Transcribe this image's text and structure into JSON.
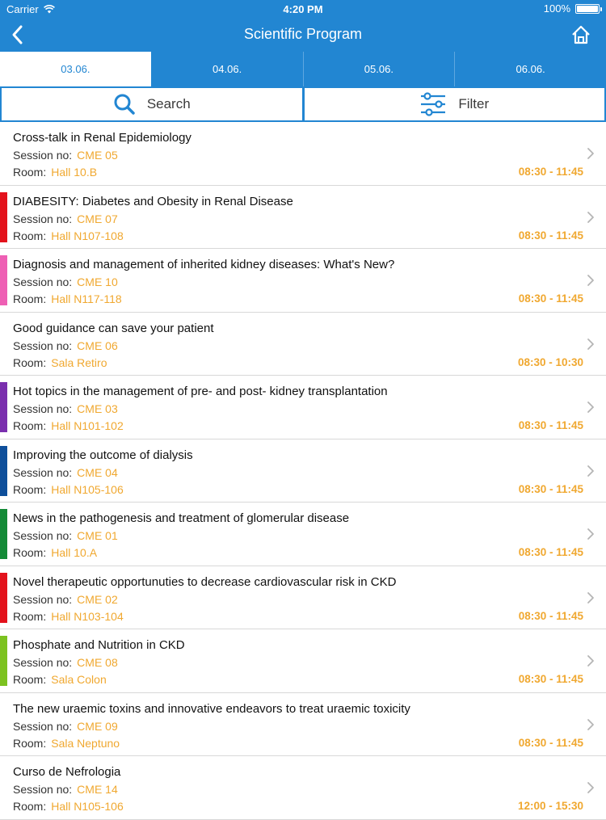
{
  "status_bar": {
    "carrier": "Carrier",
    "time": "4:20 PM",
    "battery": "100%",
    "battery_level": 1.0
  },
  "nav": {
    "title": "Scientific Program",
    "back_icon": "chevron-left-icon",
    "home_icon": "home-icon"
  },
  "tabs": [
    {
      "label": "03.06.",
      "active": true
    },
    {
      "label": "04.06.",
      "active": false
    },
    {
      "label": "05.06.",
      "active": false
    },
    {
      "label": "06.06.",
      "active": false
    }
  ],
  "tools": {
    "search_label": "Search",
    "filter_label": "Filter"
  },
  "labels": {
    "session": "Session no:",
    "room": "Room:"
  },
  "colors": {
    "brand": "#2286d2",
    "accent_orange": "#f0a830"
  },
  "sessions": [
    {
      "title": "Cross-talk in Renal Epidemiology",
      "session": "CME 05",
      "room": "Hall 10.B",
      "time": "08:30 - 11:45",
      "color": ""
    },
    {
      "title": "DIABESITY: Diabetes and Obesity in Renal Disease",
      "session": "CME 07",
      "room": "Hall N107-108",
      "time": "08:30 - 11:45",
      "color": "#e3121c"
    },
    {
      "title": "Diagnosis and management of inherited kidney diseases: What's New?",
      "session": "CME 10",
      "room": "Hall N117-118",
      "time": "08:30 - 11:45",
      "color": "#ee5fb4"
    },
    {
      "title": "Good guidance can save your patient",
      "session": "CME 06",
      "room": "Sala Retiro",
      "time": "08:30 - 10:30",
      "color": ""
    },
    {
      "title": "Hot topics in the management of pre- and post- kidney transplantation",
      "session": "CME 03",
      "room": "Hall N101-102",
      "time": "08:30 - 11:45",
      "color": "#7a2fae"
    },
    {
      "title": "Improving the outcome of dialysis",
      "session": "CME 04",
      "room": "Hall N105-106",
      "time": "08:30 - 11:45",
      "color": "#0e4f9b"
    },
    {
      "title": "News in the pathogenesis and treatment of glomerular disease",
      "session": "CME 01",
      "room": "Hall 10.A",
      "time": "08:30 - 11:45",
      "color": "#138a36"
    },
    {
      "title": "Novel therapeutic opportunuties to decrease cardiovascular risk in CKD",
      "session": "CME 02",
      "room": "Hall N103-104",
      "time": "08:30 - 11:45",
      "color": "#e3121c"
    },
    {
      "title": "Phosphate and Nutrition in CKD",
      "session": "CME 08",
      "room": "Sala Colon",
      "time": "08:30 - 11:45",
      "color": "#7cc220"
    },
    {
      "title": "The new uraemic toxins and innovative endeavors to treat uraemic toxicity",
      "session": "CME 09",
      "room": "Sala Neptuno",
      "time": "08:30 - 11:45",
      "color": ""
    },
    {
      "title": "Curso de Nefrologia",
      "session": "CME 14",
      "room": "Hall N105-106",
      "time": "12:00 - 15:30",
      "color": ""
    }
  ]
}
